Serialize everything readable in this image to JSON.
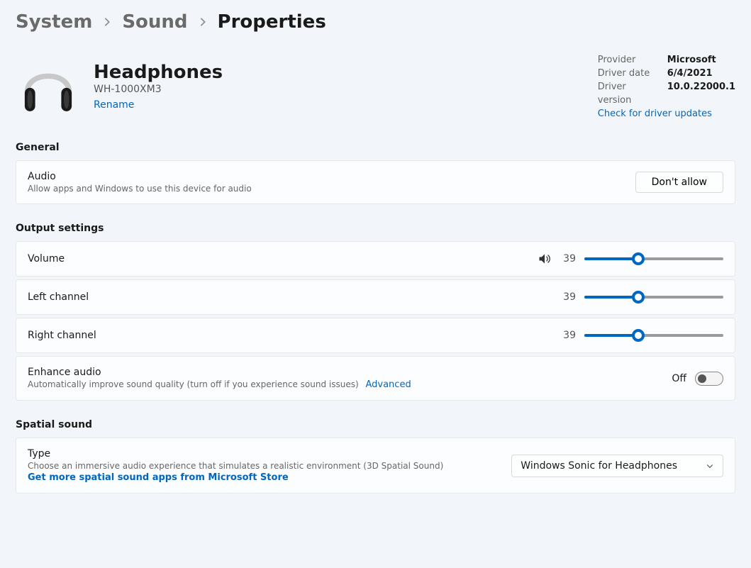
{
  "breadcrumb": {
    "system": "System",
    "sound": "Sound",
    "current": "Properties"
  },
  "device": {
    "name": "Headphones",
    "model": "WH-1000XM3",
    "rename_label": "Rename"
  },
  "driver": {
    "provider_label": "Provider",
    "provider_value": "Microsoft",
    "date_label": "Driver date",
    "date_value": "6/4/2021",
    "version_label": "Driver version",
    "version_value": "10.0.22000.1",
    "update_link": "Check for driver updates"
  },
  "sections": {
    "general": "General",
    "output": "Output settings",
    "spatial": "Spatial sound"
  },
  "general_card": {
    "title": "Audio",
    "subtitle": "Allow apps and Windows to use this device for audio",
    "button": "Don't allow"
  },
  "output": {
    "volume": {
      "label": "Volume",
      "value": 39
    },
    "left": {
      "label": "Left channel",
      "value": 39
    },
    "right": {
      "label": "Right channel",
      "value": 39
    },
    "enhance": {
      "title": "Enhance audio",
      "subtitle": "Automatically improve sound quality (turn off if you experience sound issues)",
      "advanced_link": "Advanced",
      "state": "Off"
    }
  },
  "spatial": {
    "title": "Type",
    "subtitle": "Choose an immersive audio experience that simulates a realistic environment (3D Spatial Sound)",
    "store_link": "Get more spatial sound apps from Microsoft Store",
    "selected": "Windows Sonic for Headphones"
  }
}
